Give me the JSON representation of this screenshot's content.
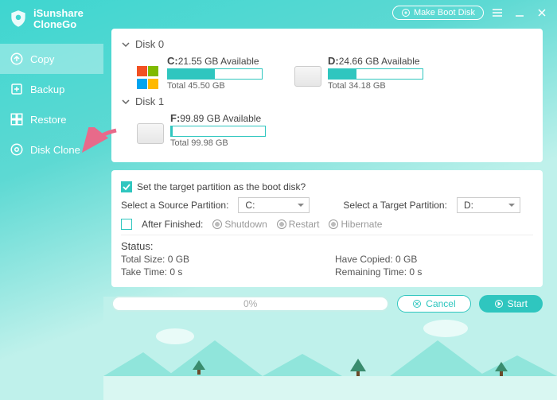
{
  "app": {
    "name1": "iSunshare",
    "name2": "CloneGo"
  },
  "titlebar": {
    "boot": "Make Boot Disk"
  },
  "sidebar": {
    "items": [
      {
        "label": "Copy"
      },
      {
        "label": "Backup"
      },
      {
        "label": "Restore"
      },
      {
        "label": "Disk Clone"
      }
    ]
  },
  "disks": {
    "d0": {
      "title": "Disk 0",
      "p0": {
        "letter": "C:",
        "avail": "21.55 GB Available",
        "total": "Total 45.50 GB",
        "fillPct": 50
      },
      "p1": {
        "letter": "D:",
        "avail": "24.66 GB Available",
        "total": "Total 34.18 GB",
        "fillPct": 30
      }
    },
    "d1": {
      "title": "Disk 1",
      "p0": {
        "letter": "F:",
        "avail": "99.89 GB Available",
        "total": "Total 99.98 GB",
        "fillPct": 2
      }
    }
  },
  "options": {
    "setBoot": "Set the target partition as the boot disk?",
    "sourceLabel": "Select a Source Partition:",
    "sourceValue": "C:",
    "targetLabel": "Select a Target Partition:",
    "targetValue": "D:",
    "afterLabel": "After Finished:",
    "opt1": "Shutdown",
    "opt2": "Restart",
    "opt3": "Hibernate"
  },
  "status": {
    "title": "Status:",
    "totalSize": "Total Size: 0 GB",
    "haveCopied": "Have Copied: 0 GB",
    "takeTime": "Take Time: 0 s",
    "remaining": "Remaining Time: 0 s"
  },
  "footer": {
    "progress": "0%",
    "cancel": "Cancel",
    "start": "Start"
  }
}
